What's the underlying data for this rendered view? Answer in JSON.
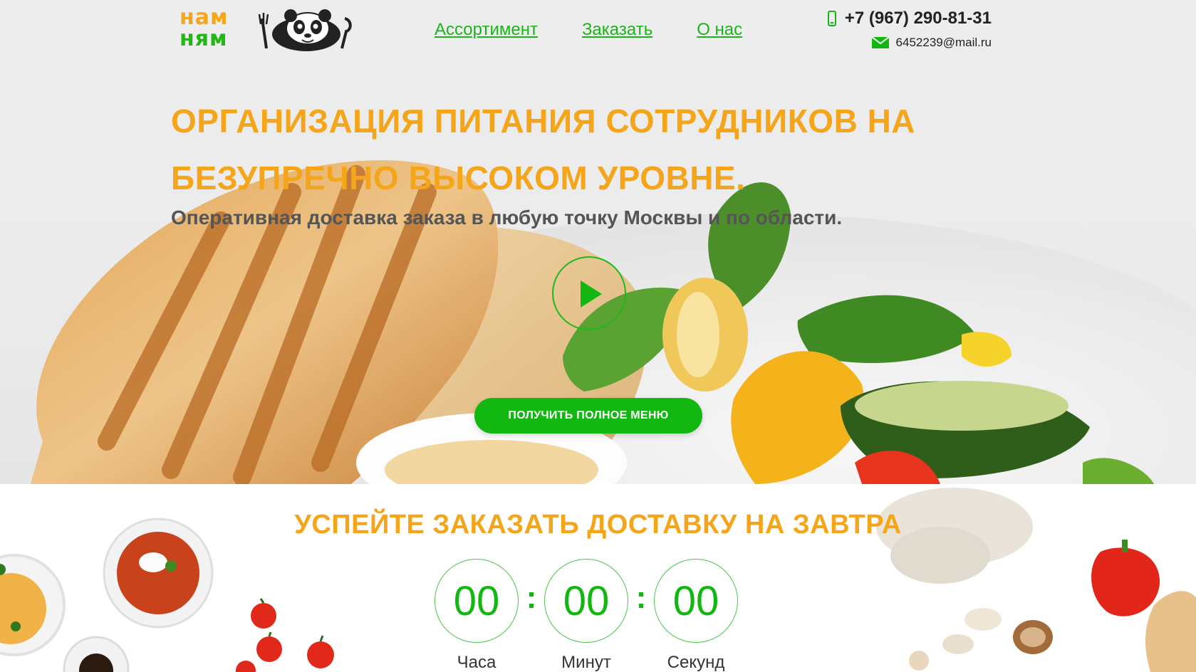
{
  "header": {
    "logo": {
      "line1": "нам",
      "line2": "ням"
    },
    "nav": [
      {
        "label": "Ассортимент"
      },
      {
        "label": "Заказать"
      },
      {
        "label": "О нас"
      }
    ],
    "phone": "+7 (967) 290-81-31",
    "email": "6452239@mail.ru"
  },
  "hero": {
    "title": "ОРГАНИЗАЦИЯ ПИТАНИЯ СОТРУДНИКОВ НА БЕЗУПРЕЧНО ВЫСОКОМ УРОВНЕ.",
    "subtitle": "Оперативная доставка заказа в любую точку Москвы и по области.",
    "cta_label": "ПОЛУЧИТЬ ПОЛНОЕ МЕНЮ"
  },
  "countdown": {
    "title": "УСПЕЙТЕ ЗАКАЗАТЬ ДОСТАВКУ НА ЗАВТРА",
    "hours": "00",
    "minutes": "00",
    "seconds": "00",
    "hours_label": "Часа",
    "minutes_label": "Минут",
    "seconds_label": "Секунд",
    "separator": ":"
  },
  "colors": {
    "accent_orange": "#f5a51a",
    "accent_green": "#12b811",
    "text_dark": "#222222"
  },
  "icons": [
    "phone-icon",
    "mail-icon",
    "play-icon",
    "panda-logo-icon"
  ]
}
